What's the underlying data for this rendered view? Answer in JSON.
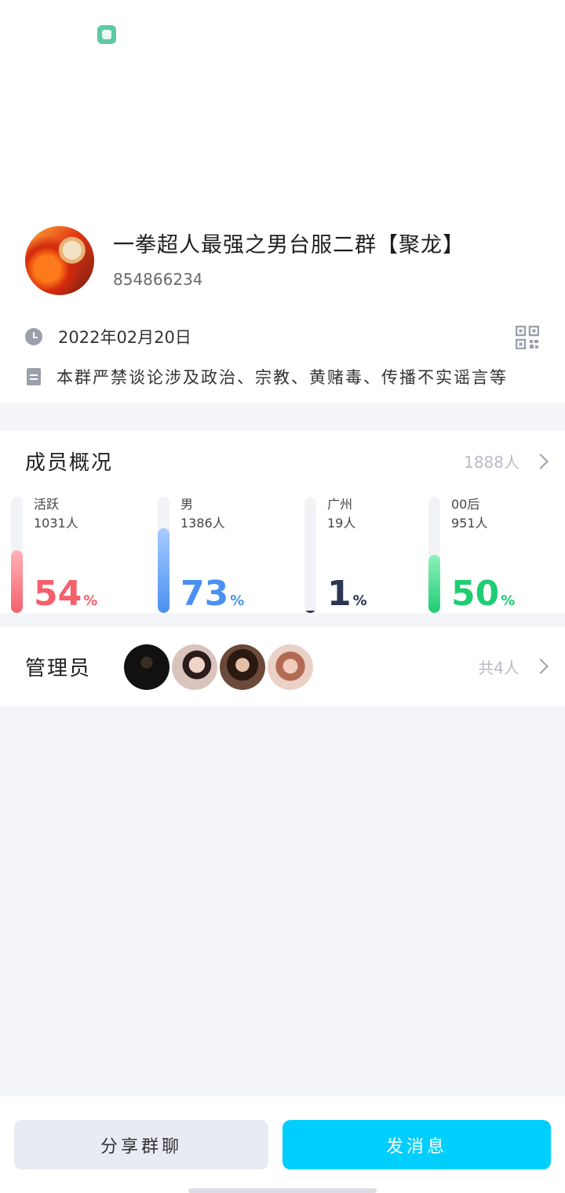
{
  "group": {
    "name": "一拳超人最强之男台服二群【聚龙】",
    "id": "854866234",
    "avatar_icon": "group-avatar-one-punch-man",
    "created_date": "2022年02月20日",
    "description": "本群严禁谈论涉及政治、宗教、黄赌毒、传播不实谣言等"
  },
  "icons": {
    "status": "app-notification-icon",
    "clock": "clock-icon",
    "document": "document-icon",
    "qr": "qr-code-icon",
    "chevron": "chevron-right-icon"
  },
  "members": {
    "title": "成员概况",
    "count": "1888人",
    "stats": [
      {
        "label": "活跃",
        "sub": "1031人",
        "percent": "54",
        "unit": "%",
        "fraction": 0.54,
        "color": "#f4606c",
        "color_light": "#ffb3b8"
      },
      {
        "label": "男",
        "sub": "1386人",
        "percent": "73",
        "unit": "%",
        "fraction": 0.73,
        "color": "#4a90f0",
        "color_light": "#a9cbff"
      },
      {
        "label": "广州",
        "sub": "19人",
        "percent": "1",
        "unit": "%",
        "fraction": 0.01,
        "color": "#2c3550",
        "color_light": "#2c3550"
      },
      {
        "label": "00后",
        "sub": "951人",
        "percent": "50",
        "unit": "%",
        "fraction": 0.5,
        "color": "#1fce72",
        "color_light": "#8ff0bd"
      }
    ]
  },
  "admins": {
    "title": "管理员",
    "count": "共4人"
  },
  "actions": {
    "share": "分享群聊",
    "send": "发消息"
  }
}
